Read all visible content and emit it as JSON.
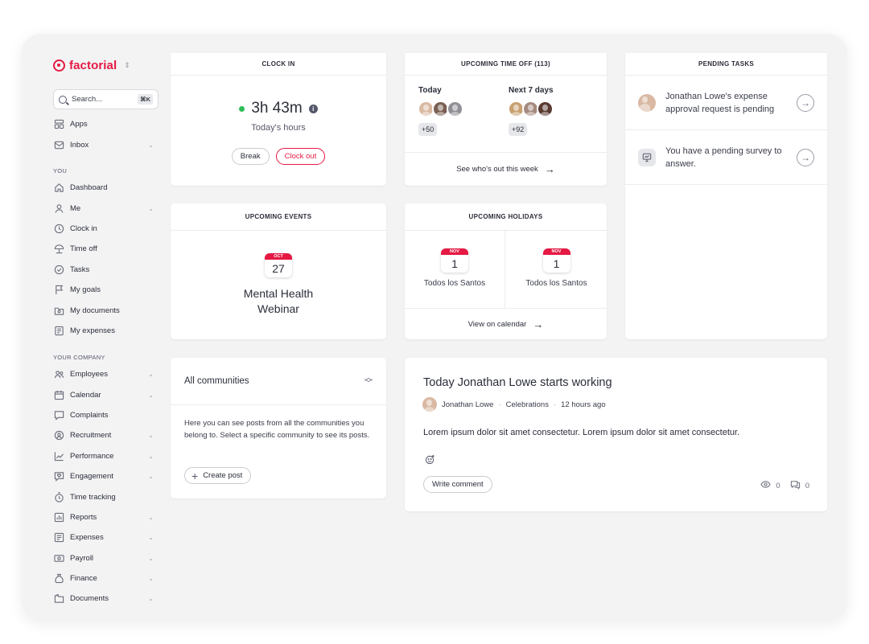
{
  "brand": {
    "name": "factorial",
    "switch_glyph": "⇕"
  },
  "search": {
    "placeholder": "Search...",
    "shortcut": "⌘K"
  },
  "nav_top": [
    {
      "label": "Apps",
      "icon": "apps-icon",
      "chevron": false
    },
    {
      "label": "Inbox",
      "icon": "inbox-icon",
      "chevron": true
    }
  ],
  "section_you": "YOU",
  "nav_you": [
    {
      "label": "Dashboard",
      "icon": "home-icon",
      "chevron": false
    },
    {
      "label": "Me",
      "icon": "user-icon",
      "chevron": true
    },
    {
      "label": "Clock in",
      "icon": "clock-icon",
      "chevron": false
    },
    {
      "label": "Time off",
      "icon": "umbrella-icon",
      "chevron": false
    },
    {
      "label": "Tasks",
      "icon": "check-circle-icon",
      "chevron": false
    },
    {
      "label": "My goals",
      "icon": "flag-icon",
      "chevron": false
    },
    {
      "label": "My documents",
      "icon": "folder-icon",
      "chevron": false
    },
    {
      "label": "My expenses",
      "icon": "receipt-icon",
      "chevron": false
    }
  ],
  "section_company": "YOUR COMPANY",
  "nav_company": [
    {
      "label": "Employees",
      "icon": "people-icon",
      "chevron": true
    },
    {
      "label": "Calendar",
      "icon": "calendar-icon",
      "chevron": true
    },
    {
      "label": "Complaints",
      "icon": "chat-icon",
      "chevron": false
    },
    {
      "label": "Recruitment",
      "icon": "search-person-icon",
      "chevron": true
    },
    {
      "label": "Performance",
      "icon": "chart-icon",
      "chevron": true
    },
    {
      "label": "Engagement",
      "icon": "heart-chat-icon",
      "chevron": true
    },
    {
      "label": "Time tracking",
      "icon": "stopwatch-icon",
      "chevron": false
    },
    {
      "label": "Reports",
      "icon": "report-icon",
      "chevron": true
    },
    {
      "label": "Expenses",
      "icon": "expenses-icon",
      "chevron": true
    },
    {
      "label": "Payroll",
      "icon": "payroll-icon",
      "chevron": true
    },
    {
      "label": "Finance",
      "icon": "money-bag-icon",
      "chevron": true
    },
    {
      "label": "Documents",
      "icon": "documents-icon",
      "chevron": true
    }
  ],
  "clock_in": {
    "title": "CLOCK IN",
    "time": "3h 43m",
    "subtitle": "Today's hours",
    "break_label": "Break",
    "clock_out_label": "Clock out",
    "status_color": "#2ebd59"
  },
  "time_off": {
    "title": "UPCOMING TIME OFF (113)",
    "today_label": "Today",
    "today_count": "+50",
    "next_label": "Next 7 days",
    "next_count": "+92",
    "link": "See who's out this week"
  },
  "pending_tasks": {
    "title": "PENDING TASKS",
    "items": [
      {
        "text": "Jonathan Lowe's expense approval request is pending",
        "icon": "avatar"
      },
      {
        "text": "You have a pending survey to answer.",
        "icon": "survey-icon"
      }
    ]
  },
  "events": {
    "title": "UPCOMING EVENTS",
    "month": "OCT",
    "day": "27",
    "name": "Mental Health Webinar"
  },
  "holidays": {
    "title": "UPCOMING HOLIDAYS",
    "items": [
      {
        "month": "NOV",
        "day": "1",
        "name": "Todos los Santos"
      },
      {
        "month": "NOV",
        "day": "1",
        "name": "Todos los Santos"
      }
    ],
    "link": "View on calendar"
  },
  "communities": {
    "selector": "All communities",
    "description": "Here you can see posts from all the communities you belong to. Select a specific community to see its posts.",
    "create_label": "Create post"
  },
  "post": {
    "title": "Today Jonathan Lowe starts working",
    "author": "Jonathan Lowe",
    "community": "Celebrations",
    "time": "12 hours ago",
    "body": "Lorem ipsum dolor sit amet consectetur. Lorem ipsum dolor sit amet consectetur.",
    "comment_label": "Write comment",
    "views": "0",
    "comments": "0"
  },
  "colors": {
    "accent": "#e51943",
    "background": "#f3f3f4"
  }
}
